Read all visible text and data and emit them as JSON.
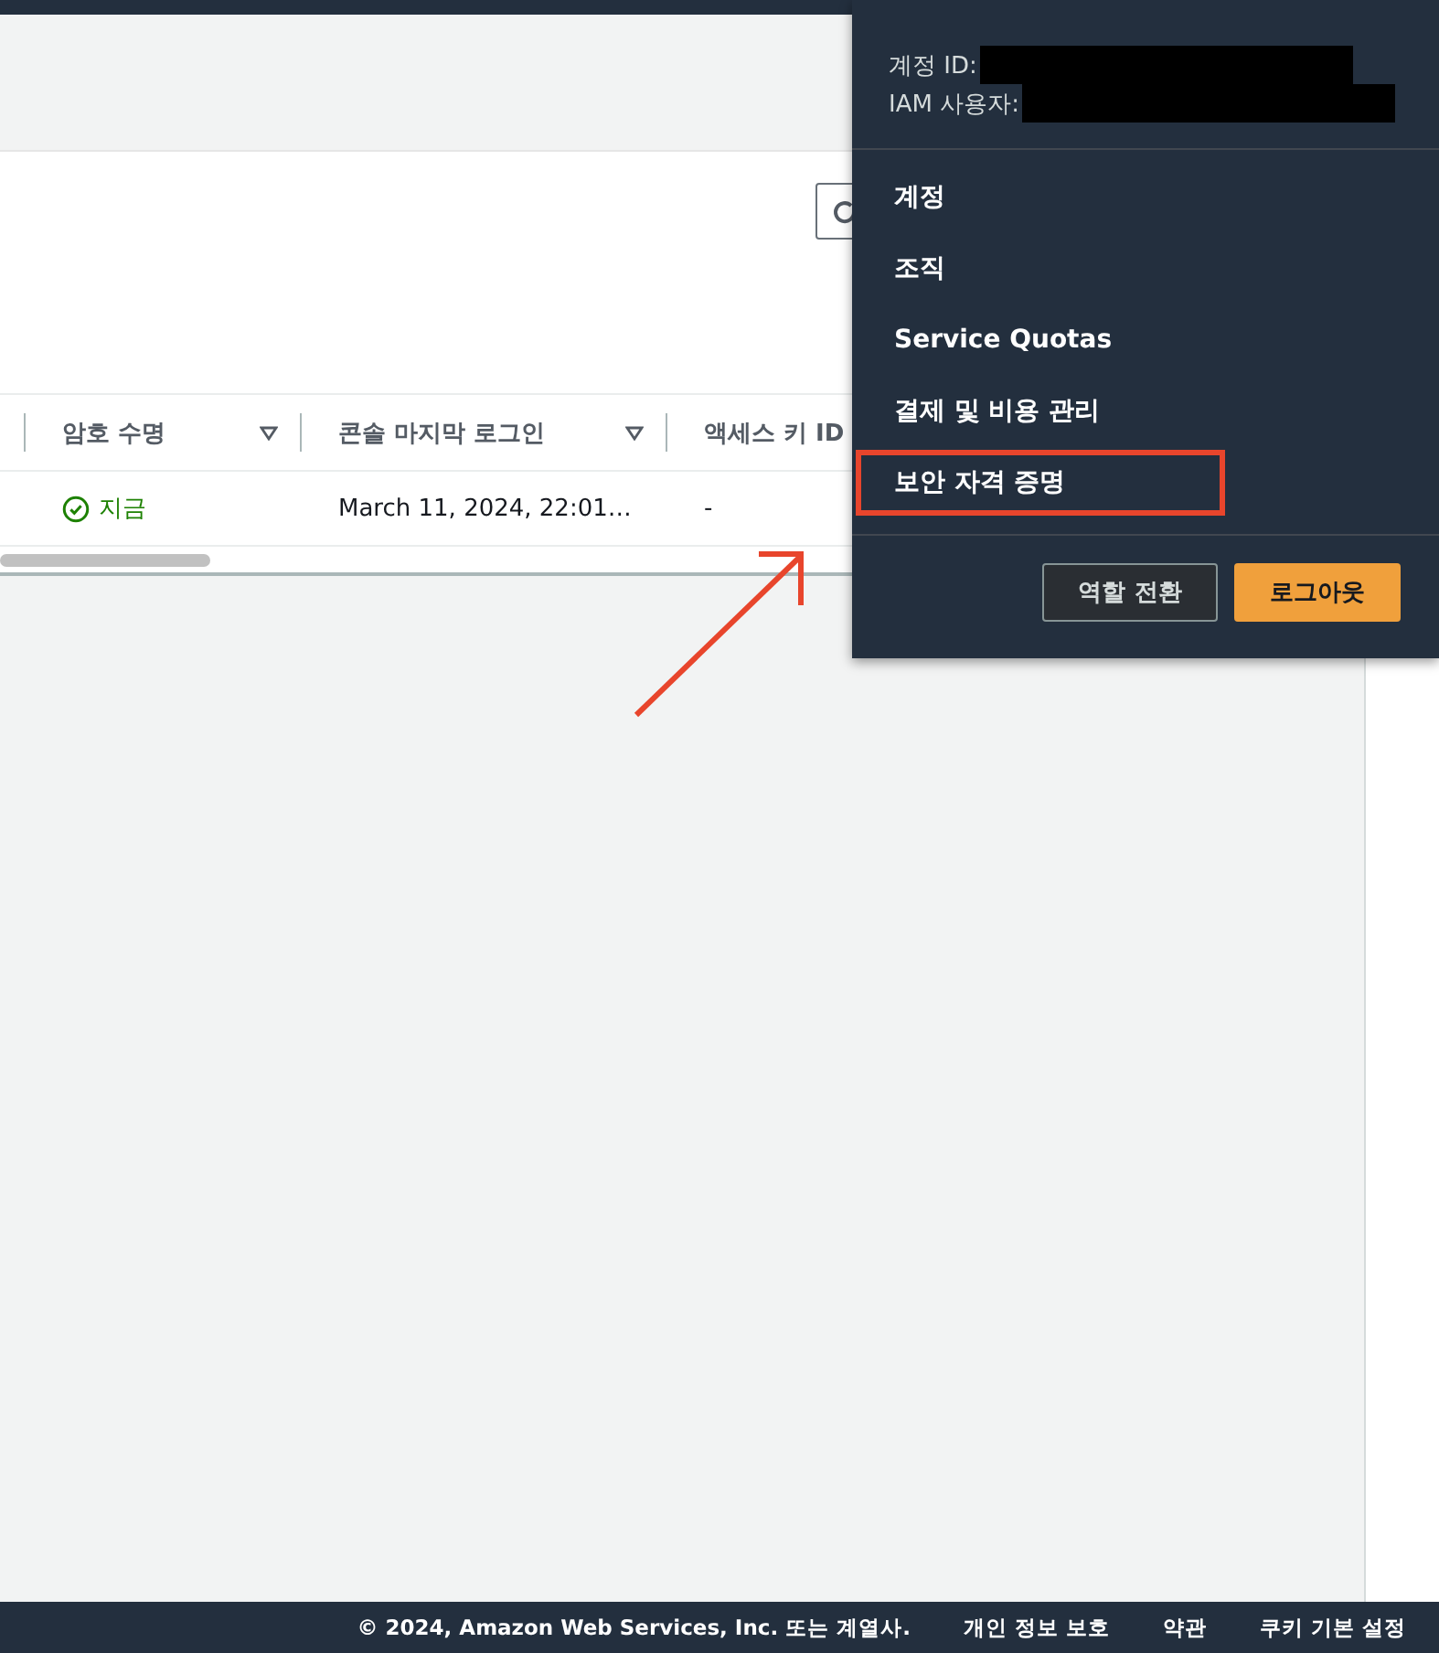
{
  "table": {
    "columns": [
      {
        "label": "암호 수명",
        "sortable": true
      },
      {
        "label": "콘솔 마지막 로그인",
        "sortable": true
      },
      {
        "label": "액세스 키 ID"
      }
    ],
    "rows": [
      {
        "password_age": "지금",
        "last_login": "March 11, 2024, 22:01…",
        "access_key_id": "-"
      }
    ]
  },
  "dropdown": {
    "account_id_label": "계정 ID:",
    "iam_user_label": "IAM 사용자:",
    "menu_items": [
      {
        "label": "계정",
        "highlighted": false
      },
      {
        "label": "조직",
        "highlighted": false
      },
      {
        "label": "Service Quotas",
        "highlighted": false
      },
      {
        "label": "결제 및 비용 관리",
        "highlighted": false
      },
      {
        "label": "보안 자격 증명",
        "highlighted": true
      }
    ],
    "buttons": [
      {
        "label": "역할 전환",
        "kind": "secondary"
      },
      {
        "label": "로그아웃",
        "kind": "primary"
      }
    ]
  },
  "footer": {
    "copyright": "© 2024, Amazon Web Services, Inc. 또는 계열사.",
    "links": [
      "개인 정보 보호",
      "약관",
      "쿠키 기본 설정"
    ]
  }
}
